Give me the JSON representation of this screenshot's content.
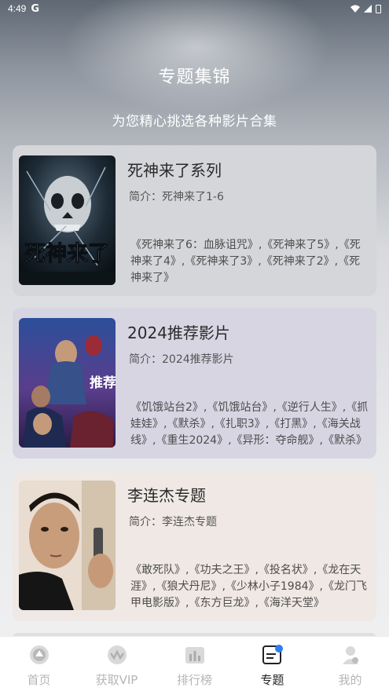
{
  "status": {
    "time": "4:49",
    "carrier_icon": "G"
  },
  "header": {
    "title": "专题集锦",
    "subtitle": "为您精心挑选各种影片合集"
  },
  "collections": [
    {
      "title": "死神来了系列",
      "intro": "简介：死神来了1-6",
      "movies": "《死神来了6：血脉诅咒》,《死神来了5》,《死神来了4》,《死神来了3》,《死神来了2》,《死神来了》",
      "poster_text": "死神来了"
    },
    {
      "title": "2024推荐影片",
      "intro": "简介：2024推荐影片",
      "movies": "《饥饿站台2》,《饥饿站台》,《逆行人生》,《抓娃娃》,《默杀》,《扎职3》,《打黑》,《海关战线》,《重生2024》,《异形：夺命舰》,《默杀》",
      "poster_text": "推荐"
    },
    {
      "title": "李连杰专题",
      "intro": "简介：李连杰专题",
      "movies": "《敢死队》,《功夫之王》,《投名状》,《龙在天涯》,《狼犬丹尼》,《少林小子1984》,《龙门飞甲电影版》,《东方巨龙》,《海洋天堂》"
    }
  ],
  "tabs": [
    {
      "label": "首页",
      "icon": "home-icon",
      "active": false
    },
    {
      "label": "获取VIP",
      "icon": "vip-icon",
      "active": false
    },
    {
      "label": "排行榜",
      "icon": "ranking-icon",
      "active": false
    },
    {
      "label": "专题",
      "icon": "topic-icon",
      "active": true
    },
    {
      "label": "我的",
      "icon": "profile-icon",
      "active": false
    }
  ],
  "colors": {
    "active_tab": "#222222",
    "inactive_tab": "#b5b5b5",
    "accent": "#2f7df6"
  }
}
